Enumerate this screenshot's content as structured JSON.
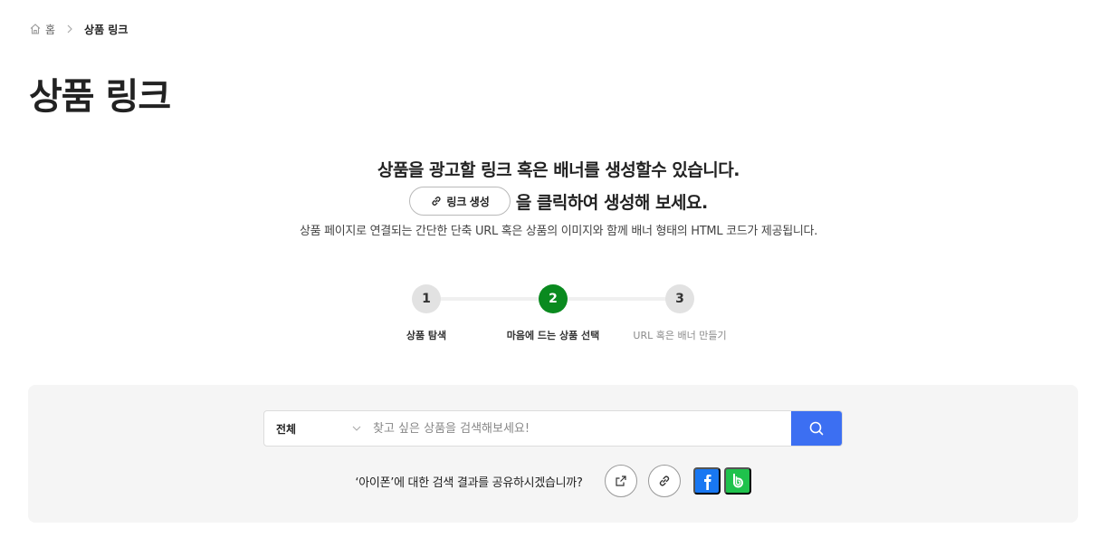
{
  "breadcrumb": {
    "home": "홈",
    "current": "상품 링크"
  },
  "page_title": "상품 링크",
  "intro": {
    "line1": "상품을 광고할 링크 혹은 배너를 생성할수 있습니다.",
    "button_label": "링크 생성",
    "line2_suffix": "을 클릭하여 생성해 보세요.",
    "line3": "상품 페이지로 연결되는 간단한 단축 URL 혹은 상품의 이미지와 함께 배너 형태의 HTML 코드가 제공됩니다."
  },
  "steps": [
    {
      "number": "1",
      "label": "상품 탐색",
      "state": "done"
    },
    {
      "number": "2",
      "label": "마음에 드는 상품 선택",
      "state": "active"
    },
    {
      "number": "3",
      "label": "URL 혹은 배너 만들기",
      "state": "future"
    }
  ],
  "search": {
    "category": "전체",
    "placeholder": "찾고 싶은 상품을 검색해보세요!",
    "value": ""
  },
  "share": {
    "text": "‘아이폰’에 대한 검색 결과를 공유하시겠습니까?"
  },
  "colors": {
    "accent_blue": "#3c6ff2",
    "step_active": "#0a8a1f",
    "facebook": "#1877f2",
    "band": "#1fc24c",
    "panel_bg": "#f5f5f5"
  },
  "icons": {
    "home": "home-icon",
    "separator": "chevron-right-icon",
    "link": "link-icon",
    "dropdown": "chevron-down-icon",
    "search": "search-icon",
    "external": "external-link-icon",
    "facebook": "facebook-icon",
    "band": "band-icon"
  }
}
